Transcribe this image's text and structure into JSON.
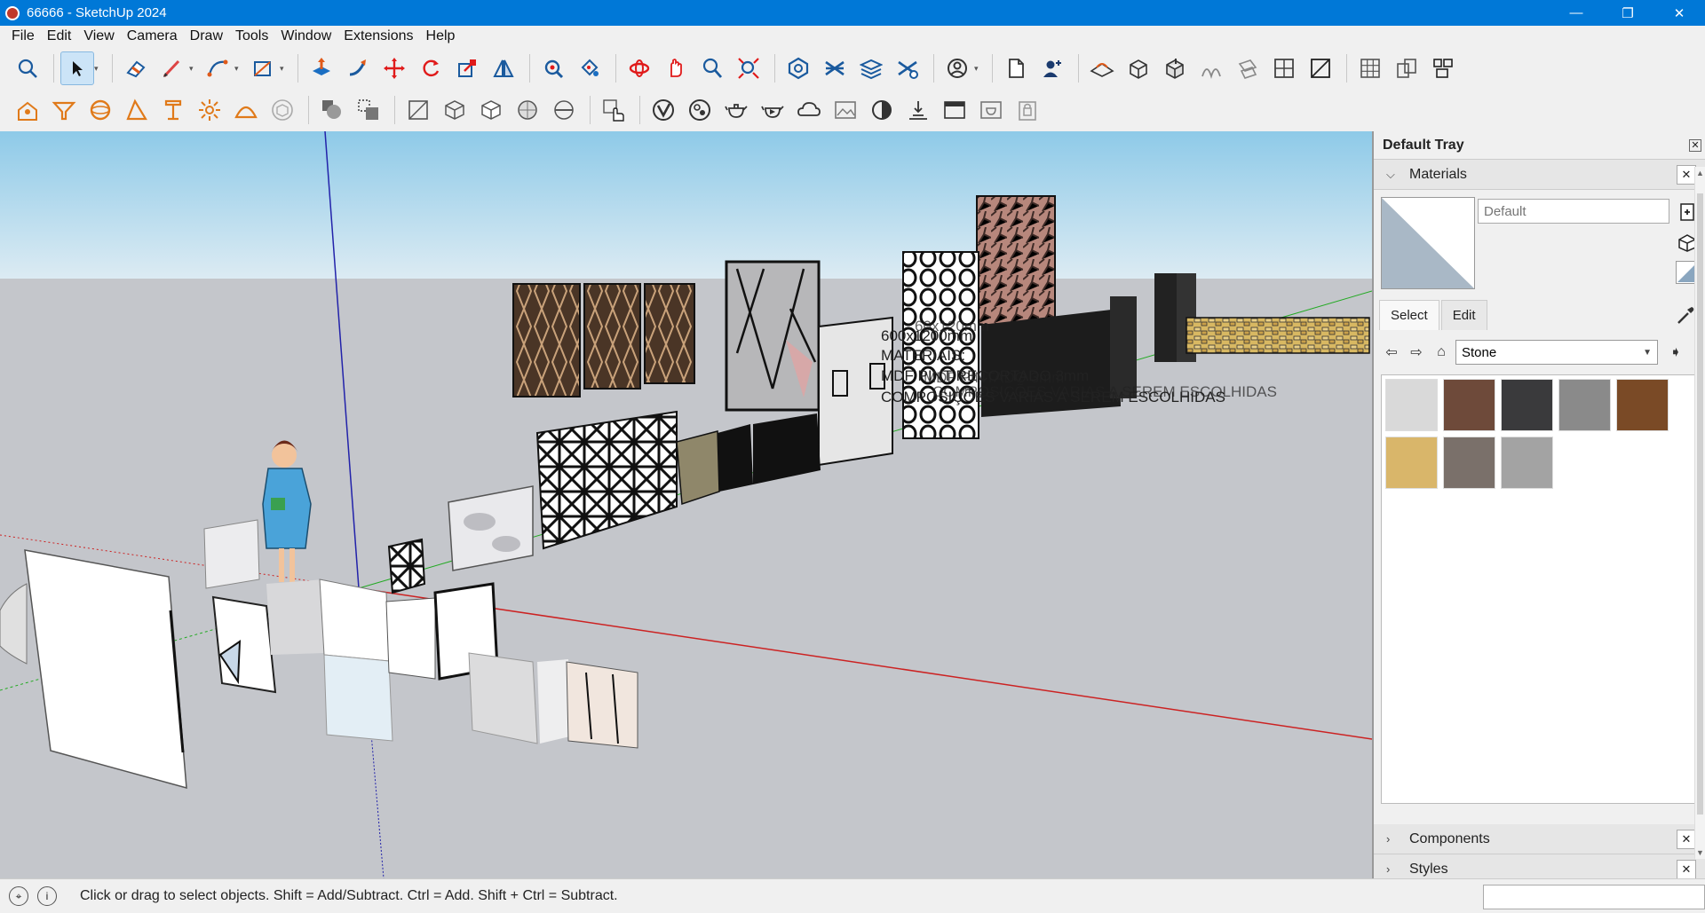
{
  "window": {
    "title": "66666 - SketchUp 2024",
    "controls": [
      "—",
      "❐",
      "✕"
    ]
  },
  "menu": [
    "File",
    "Edit",
    "View",
    "Camera",
    "Draw",
    "Tools",
    "Window",
    "Extensions",
    "Help"
  ],
  "toolbar1": [
    "search-icon",
    "select-icon",
    "eraser-icon",
    "pencil-icon",
    "arc-icon",
    "rectangle-icon",
    "push-pull-icon",
    "follow-me-icon",
    "move-icon",
    "rotate-icon",
    "scale-icon",
    "flip-icon",
    "tape-icon",
    "paint-icon",
    "section-plane-icon",
    "walk-icon",
    "zoom-icon",
    "zoom-extents-icon",
    "warehouse-icon",
    "layers-icon",
    "layers-stack-icon",
    "tags-icon",
    "account-icon",
    "new-file-icon",
    "add-user-icon",
    "sandbox-icons"
  ],
  "toolbar2": [
    "solid-tools-icons",
    "style-icons",
    "view-icons",
    "extension-icons"
  ],
  "viewport": {
    "annotation_lines": [
      "600x1200mm",
      "MATERIAIS:",
      "MDF PINT RECORTADO 3mm",
      "COMPOSIÇÕES VARIAS A SEREM ESCOLHIDAS"
    ],
    "annotation_dupe": [
      "60x120mm",
      "MDF PINTADO 3mm",
      "COMPOSIÇÕES VARIAS A SEREM ESCOLHIDAS"
    ]
  },
  "tray": {
    "title": "Default Tray",
    "materials": {
      "header": "Materials",
      "name_placeholder": "Default",
      "tabs": [
        "Select",
        "Edit"
      ],
      "active_tab": "Select",
      "collection": "Stone",
      "swatches": [
        "#d9d9d9",
        "#6e4a3a",
        "#3a3a3c",
        "#8a8a8a",
        "#7a4a26",
        "#d9b66a",
        "#7a706a",
        "#a3a3a3"
      ]
    },
    "panels": [
      "Components",
      "Styles"
    ]
  },
  "status": {
    "hint": "Click or drag to select objects. Shift = Add/Subtract. Ctrl = Add. Shift + Ctrl = Subtract."
  }
}
